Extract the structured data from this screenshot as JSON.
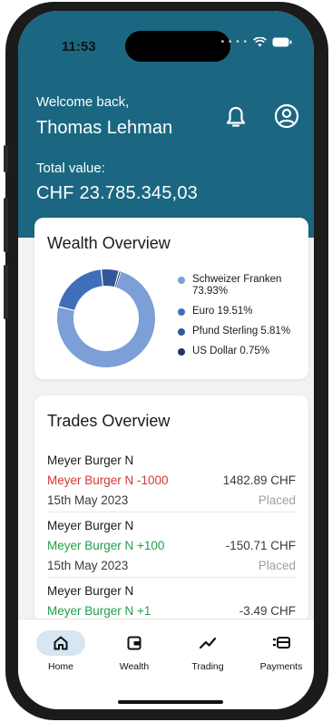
{
  "status_bar": {
    "time": "11:53"
  },
  "header": {
    "welcome": "Welcome back,",
    "user_name": "Thomas Lehman",
    "total_label": "Total value:",
    "total_value": "CHF 23.785.345,03"
  },
  "wealth": {
    "title": "Wealth Overview",
    "legend": [
      {
        "label": "Schweizer Franken 73.93%",
        "color": "#7b9fd6",
        "percent": 73.93
      },
      {
        "label": "Euro 19.51%",
        "color": "#3f6fb8",
        "percent": 19.51
      },
      {
        "label": "Pfund Sterling 5.81%",
        "color": "#34579a",
        "percent": 5.81
      },
      {
        "label": "US Dollar 0.75%",
        "color": "#1f3566",
        "percent": 0.75
      }
    ]
  },
  "trades": {
    "title": "Trades Overview",
    "items": [
      {
        "name": "Meyer Burger N",
        "order": "Meyer Burger N -1000",
        "order_color": "#d83434",
        "amount": "1482.89 CHF",
        "date": "15th May 2023",
        "status": "Placed"
      },
      {
        "name": "Meyer Burger N",
        "order": "Meyer Burger N +100",
        "order_color": "#20a04a",
        "amount": "-150.71 CHF",
        "date": "15th May 2023",
        "status": "Placed"
      },
      {
        "name": "Meyer Burger N",
        "order": "Meyer Burger N +1",
        "order_color": "#20a04a",
        "amount": "-3.49 CHF",
        "date": "",
        "status": ""
      }
    ]
  },
  "tabbar": {
    "tabs": [
      {
        "label": "Home",
        "icon": "home-icon",
        "active": true
      },
      {
        "label": "Wealth",
        "icon": "wallet-icon",
        "active": false
      },
      {
        "label": "Trading",
        "icon": "trend-icon",
        "active": false
      },
      {
        "label": "Payments",
        "icon": "payments-icon",
        "active": false
      }
    ]
  },
  "colors": {
    "header": "#1b6782",
    "active_tab": "#d6e6f2"
  }
}
